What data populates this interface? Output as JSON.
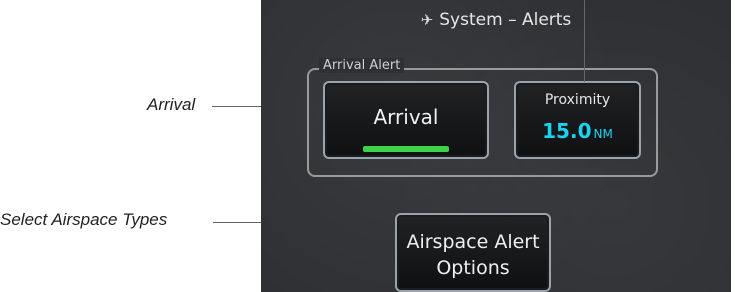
{
  "screen": {
    "title": "System – Alerts",
    "group_label": "Arrival Alert",
    "arrival_button": {
      "label": "Arrival",
      "state": "on",
      "indicator_color": "#3fd14a"
    },
    "proximity_button": {
      "label": "Proximity",
      "value": "15.0",
      "unit": "NM",
      "value_color": "#19d3f0"
    },
    "airspace_button": {
      "line1": "Airspace Alert",
      "line2": "Options"
    }
  },
  "callouts": {
    "arrival": "Arrival",
    "airspace": "Select Airspace Types"
  },
  "icons": {
    "title_icon": "airplane-icon"
  }
}
